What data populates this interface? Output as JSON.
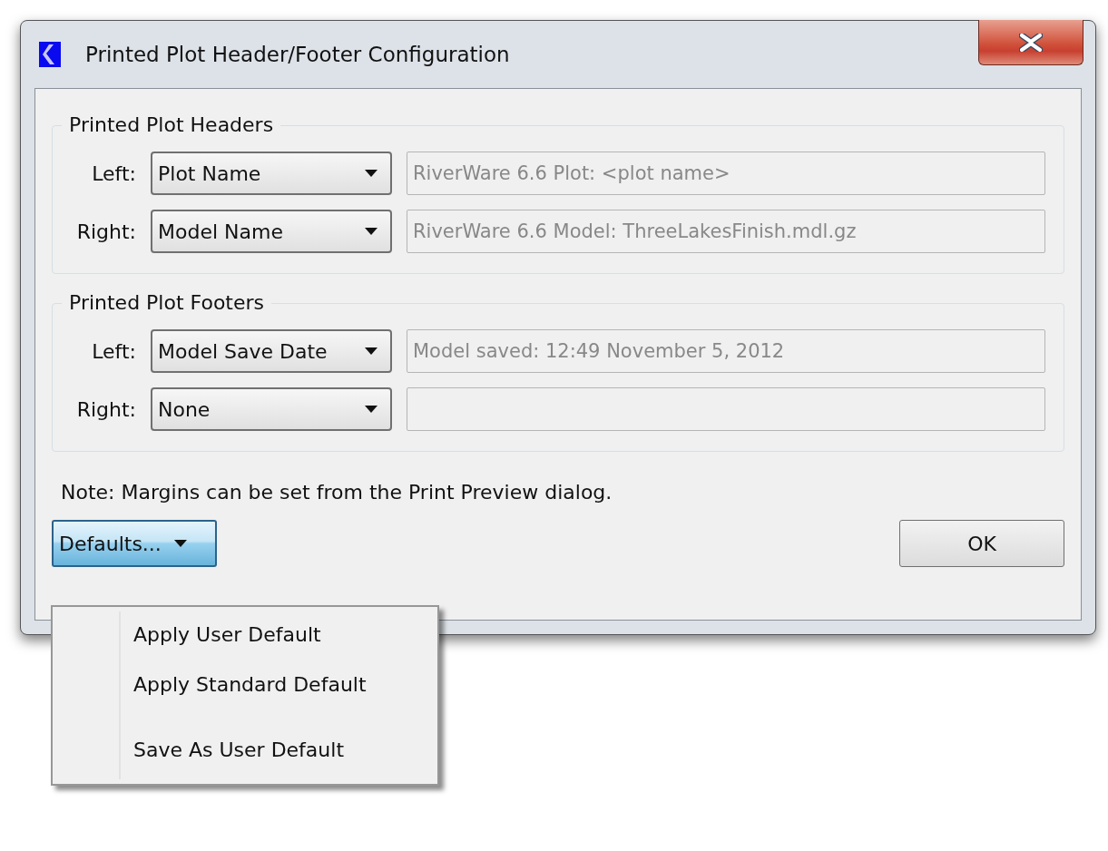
{
  "window": {
    "title": "Printed Plot Header/Footer Configuration"
  },
  "groups": [
    {
      "title": "Printed Plot Headers",
      "rows": [
        {
          "label": "Left:",
          "selection": "Plot Name",
          "preview": "RiverWare 6.6 Plot: <plot name>",
          "disabled": true
        },
        {
          "label": "Right:",
          "selection": "Model Name",
          "preview": "RiverWare 6.6 Model: ThreeLakesFinish.mdl.gz",
          "disabled": true
        }
      ]
    },
    {
      "title": "Printed Plot Footers",
      "rows": [
        {
          "label": "Left:",
          "selection": "Model Save Date",
          "preview": "Model saved: 12:49 November 5, 2012",
          "disabled": true
        },
        {
          "label": "Right:",
          "selection": "None",
          "disabled": true
        }
      ]
    }
  ],
  "note": "Note: Margins can be set from the Print Preview dialog.",
  "defaults_button": {
    "label": "Defaults...",
    "pressed": true
  },
  "ok_button": {
    "label": "OK"
  },
  "menu": [
    {
      "kind": "item",
      "label": "Apply User Default"
    },
    {
      "kind": "item",
      "label": "Apply Standard Default"
    },
    {
      "kind": "separator"
    },
    {
      "kind": "item",
      "label": "Save As User Default"
    }
  ]
}
